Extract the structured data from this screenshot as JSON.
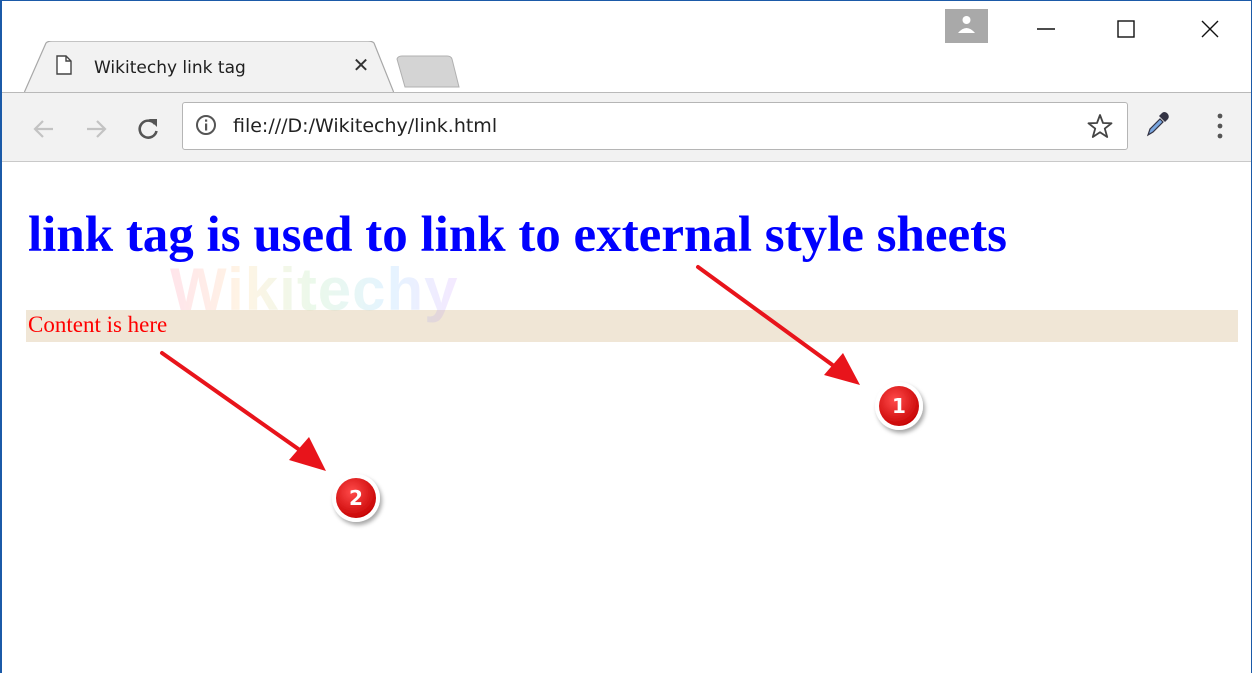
{
  "tab": {
    "title": "Wikitechy link tag",
    "close_glyph": "✕"
  },
  "address_bar": {
    "url": "file:///D:/Wikitechy/link.html"
  },
  "page": {
    "heading": "link tag is used to link to external style sheets",
    "paragraph": "Content is here",
    "watermark": "Wikitechy"
  },
  "annotations": [
    {
      "label": "1"
    },
    {
      "label": "2"
    }
  ],
  "colors": {
    "heading": "#0000ff",
    "paragraph": "#ff0000",
    "paragraph_background": "#f0e6d6",
    "annotation": "#e8141b"
  },
  "icons": {
    "tab": "page-icon",
    "back": "back-arrow-icon",
    "forward": "forward-arrow-icon",
    "reload": "reload-icon",
    "info": "info-icon",
    "bookmark": "star-icon",
    "extension": "eyedropper-icon",
    "menu": "kebab-menu-icon",
    "profile": "person-icon",
    "minimize": "minimize-icon",
    "maximize": "maximize-icon",
    "close": "close-icon"
  }
}
